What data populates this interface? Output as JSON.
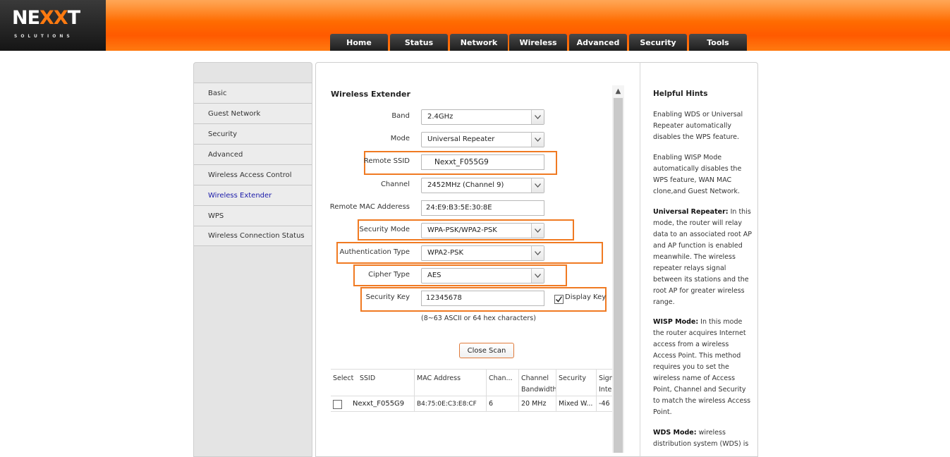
{
  "brand": {
    "name_a": "NE",
    "name_x": "XX",
    "name_b": "T",
    "tagline": "SOLUTIONS"
  },
  "nav": [
    "Home",
    "Status",
    "Network",
    "Wireless",
    "Advanced",
    "Security",
    "Tools"
  ],
  "sidebar": {
    "items": [
      {
        "label": "Basic"
      },
      {
        "label": "Guest Network"
      },
      {
        "label": "Security"
      },
      {
        "label": "Advanced"
      },
      {
        "label": "Wireless Access Control"
      },
      {
        "label": "Wireless Extender"
      },
      {
        "label": "WPS"
      },
      {
        "label": "Wireless Connection Status"
      }
    ],
    "active": "Wireless Extender"
  },
  "section_title": "Wireless Extender",
  "form": {
    "band": {
      "label": "Band",
      "value": "2.4GHz"
    },
    "mode": {
      "label": "Mode",
      "value": "Universal Repeater"
    },
    "remote_ssid": {
      "label": "Remote SSID",
      "value": "Nexxt_F055G9"
    },
    "channel": {
      "label": "Channel",
      "value": "2452MHz (Channel 9)"
    },
    "remote_mac": {
      "label": "Remote MAC Adderess",
      "value": "24:E9:B3:5E:30:8E"
    },
    "security_mode": {
      "label": "Security Mode",
      "value": "WPA-PSK/WPA2-PSK"
    },
    "auth_type": {
      "label": "Authentication Type",
      "value": "WPA2-PSK"
    },
    "cipher_type": {
      "label": "Cipher Type",
      "value": "AES"
    },
    "security_key": {
      "label": "Security Key",
      "value": "12345678"
    },
    "display_key": {
      "label": "Display Key",
      "checked": true
    },
    "key_note": "(8~63 ASCII or 64 hex characters)",
    "close_scan": "Close Scan"
  },
  "table": {
    "headers": [
      "Select",
      "SSID",
      "MAC Address",
      "Chan...",
      "Channel Bandwidth",
      "Security",
      "Sign Inte"
    ],
    "rows": [
      {
        "ssid": "Nexxt_F055G9",
        "mac": "B4:75:0E:C3:E8:CF",
        "channel": "6",
        "bandwidth": "20 MHz",
        "security": "Mixed W...",
        "signal": "-46"
      }
    ]
  },
  "hints": {
    "title": "Helpful Hints",
    "p1": "Enabling WDS or Universal Repeater automatically disables the WPS feature.",
    "p2": "Enabling WISP Mode automatically disables the WPS feature, WAN MAC clone,and Guest Network.",
    "p3_bold": "Universal Repeater:",
    "p3": " In this mode, the router will relay data to an associated root AP and AP function is enabled meanwhile. The wireless repeater relays signal between its stations and the root AP for greater wireless range.",
    "p4_bold": "WISP Mode:",
    "p4": " In this mode the router acquires Internet access from a wireless Access Point. This method requires you to set the wireless name of Access Point, Channel and Security to match the wireless Access Point.",
    "p5_bold": "WDS Mode:",
    "p5": " wireless distribution system (WDS) is"
  },
  "colors": {
    "header_orange": "#ff6a00",
    "highlight": "#f07a22",
    "active_link": "#1a1aaa"
  }
}
